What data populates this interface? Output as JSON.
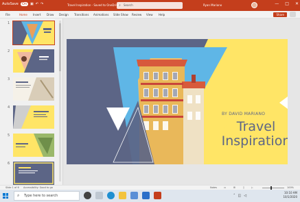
{
  "titlebar": {
    "autosave": "AutoSave",
    "autosave_state": "On",
    "document_title": "Travel Inspiration - Saved to OneDrive",
    "search_placeholder": "Search",
    "user_name": "Ryan Mariano",
    "window_controls": [
      "—",
      "□",
      "✕"
    ]
  },
  "ribbon": {
    "tabs": [
      "File",
      "Home",
      "Insert",
      "Draw",
      "Design",
      "Transitions",
      "Animations",
      "Slide Show",
      "Review",
      "View",
      "Help"
    ],
    "active_tab": "Home",
    "share_label": "Share"
  },
  "thumbnails": {
    "numbers": [
      "1",
      "2",
      "3",
      "4",
      "5",
      "6"
    ],
    "selected": 1
  },
  "slide": {
    "title_line1": "Travel",
    "title_line2": "Inspiration",
    "subtitle": "BY DAVID MARIANO"
  },
  "statusbar": {
    "slide_info": "Slide 1 of 6",
    "accessibility": "Accessibility: Good to go",
    "notes": "Notes",
    "zoom": "100%"
  },
  "taskbar": {
    "search_placeholder": "Type here to search",
    "time": "10:10 AM",
    "date": "10/1/2020"
  },
  "colors": {
    "brand": "#c43e1c",
    "slide_slate": "#5c6586",
    "slide_yellow": "#ffe566",
    "sky": "#5fb6e6"
  }
}
